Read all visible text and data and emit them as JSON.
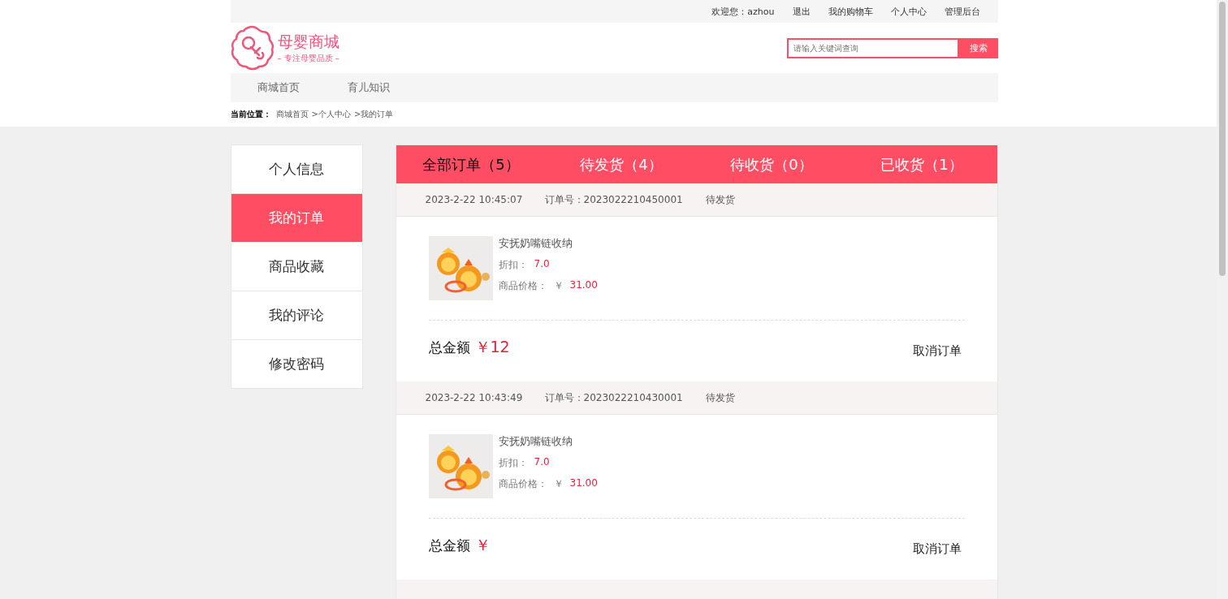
{
  "top_bar": {
    "welcome": "欢迎您：azhou",
    "links": [
      "退出",
      "我的购物车",
      "个人中心",
      "管理后台"
    ]
  },
  "logo": {
    "title": "母婴商城",
    "slogan": "– 专注母婴品质 –"
  },
  "search": {
    "placeholder": "请输入关键词查询",
    "button": "搜索"
  },
  "nav": [
    "商城首页",
    "育儿知识"
  ],
  "breadcrumb": {
    "label": "当前位置：",
    "items": [
      "商城首页",
      ">个人中心",
      ">我的订单"
    ]
  },
  "sidebar": [
    {
      "label": "个人信息",
      "selected": false
    },
    {
      "label": "我的订单",
      "selected": true
    },
    {
      "label": "商品收藏",
      "selected": false
    },
    {
      "label": "我的评论",
      "selected": false
    },
    {
      "label": "修改密码",
      "selected": false
    }
  ],
  "tabs": [
    {
      "label": "全部订单（5）",
      "selected": true
    },
    {
      "label": "待发货（4）",
      "selected": false
    },
    {
      "label": "待收货（0）",
      "selected": false
    },
    {
      "label": "已收货（1）",
      "selected": false
    }
  ],
  "orders": [
    {
      "time": "2023-2-22 10:45:07",
      "order_no": "订单号：2023022210450001",
      "status": "待发货",
      "product": {
        "name": "安抚奶嘴链收纳",
        "discount_label": "折扣：",
        "discount": "7.0",
        "price_label": "商品价格：",
        "currency": "￥",
        "price": "31.00"
      },
      "total_label": "总金额",
      "total": "￥12",
      "action": "取消订单"
    },
    {
      "time": "2023-2-22 10:43:49",
      "order_no": "订单号：2023022210430001",
      "status": "待发货",
      "product": {
        "name": "安抚奶嘴链收纳",
        "discount_label": "折扣：",
        "discount": "7.0",
        "price_label": "商品价格：",
        "currency": "￥",
        "price": "31.00"
      },
      "total_label": "总金额",
      "total": "￥",
      "action": "取消订单"
    }
  ]
}
